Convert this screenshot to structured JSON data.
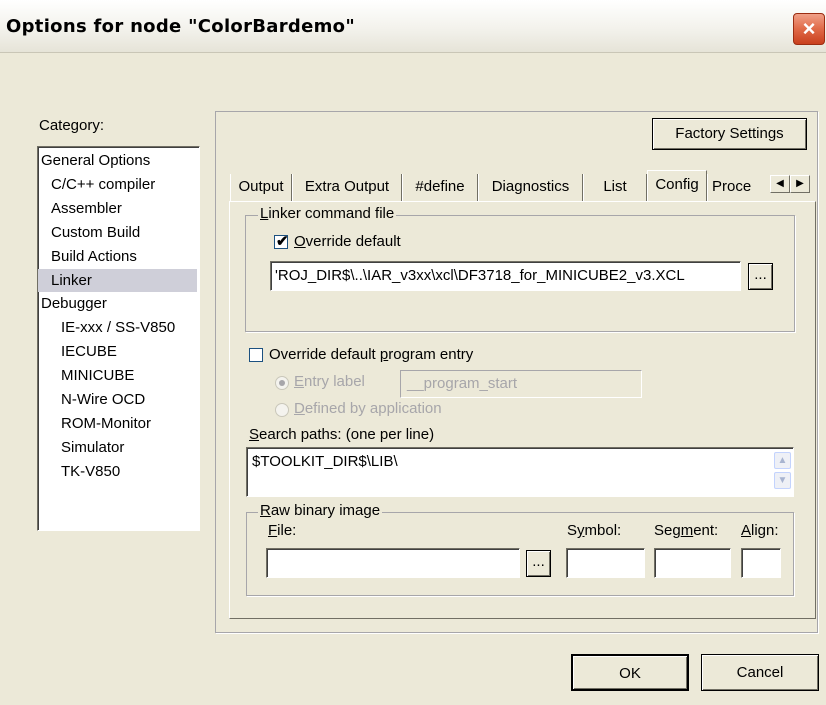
{
  "window": {
    "title": "Options for node \"ColorBardemo\"",
    "close_icon": "×"
  },
  "category": {
    "label": "Category:",
    "items": [
      {
        "label": "General Options",
        "indent": 0,
        "selected": false
      },
      {
        "label": "C/C++ compiler",
        "indent": 1,
        "selected": false
      },
      {
        "label": "Assembler",
        "indent": 1,
        "selected": false
      },
      {
        "label": "Custom Build",
        "indent": 1,
        "selected": false
      },
      {
        "label": "Build Actions",
        "indent": 1,
        "selected": false
      },
      {
        "label": "Linker",
        "indent": 1,
        "selected": true
      },
      {
        "label": "Debugger",
        "indent": 0,
        "selected": false
      },
      {
        "label": "IE-xxx / SS-V850",
        "indent": 2,
        "selected": false
      },
      {
        "label": "IECUBE",
        "indent": 2,
        "selected": false
      },
      {
        "label": "MINICUBE",
        "indent": 2,
        "selected": false
      },
      {
        "label": "N-Wire OCD",
        "indent": 2,
        "selected": false
      },
      {
        "label": "ROM-Monitor",
        "indent": 2,
        "selected": false
      },
      {
        "label": "Simulator",
        "indent": 2,
        "selected": false
      },
      {
        "label": "TK-V850",
        "indent": 2,
        "selected": false
      }
    ]
  },
  "factory_settings": "Factory Settings",
  "tabs": [
    {
      "label": "Output",
      "active": false
    },
    {
      "label": "Extra Output",
      "active": false
    },
    {
      "label": "#define",
      "active": false
    },
    {
      "label": "Diagnostics",
      "active": false
    },
    {
      "label": "List",
      "active": false
    },
    {
      "label": "Config",
      "active": true
    },
    {
      "label": "Proce",
      "active": false
    }
  ],
  "tab_scroll": {
    "left": "◀",
    "right": "▶"
  },
  "linker_command_file": {
    "group_label_ul": "L",
    "group_label_rest": "inker command file",
    "override_ul": "O",
    "override_rest": "verride default",
    "override_checked": true,
    "path": "'ROJ_DIR$\\..\\IAR_v3xx\\xcl\\DF3718_for_MINICUBE2_v3.XCL",
    "browse": "..."
  },
  "program_entry": {
    "override_pre": "Override default ",
    "override_ul": "p",
    "override_post": "rogram entry",
    "override_checked": false,
    "entry_label_ul": "E",
    "entry_label_rest": "ntry label",
    "entry_value": "__program_start",
    "defined_ul": "D",
    "defined_rest": "efined by application"
  },
  "search_paths": {
    "label_ul": "S",
    "label_rest": "earch paths:  (one per line)",
    "value": "$TOOLKIT_DIR$\\LIB\\",
    "scroll_up": "▲",
    "scroll_down": "▼"
  },
  "raw_binary": {
    "group_ul": "R",
    "group_rest": "aw binary image",
    "file_ul": "F",
    "file_rest": "ile:",
    "symbol_pre": "S",
    "symbol_ul": "y",
    "symbol_rest": "mbol:",
    "segment_pre": "Seg",
    "segment_ul": "m",
    "segment_rest": "ent:",
    "align_ul": "A",
    "align_rest": "lign:",
    "browse": "..."
  },
  "buttons": {
    "ok": "OK",
    "cancel": "Cancel"
  }
}
